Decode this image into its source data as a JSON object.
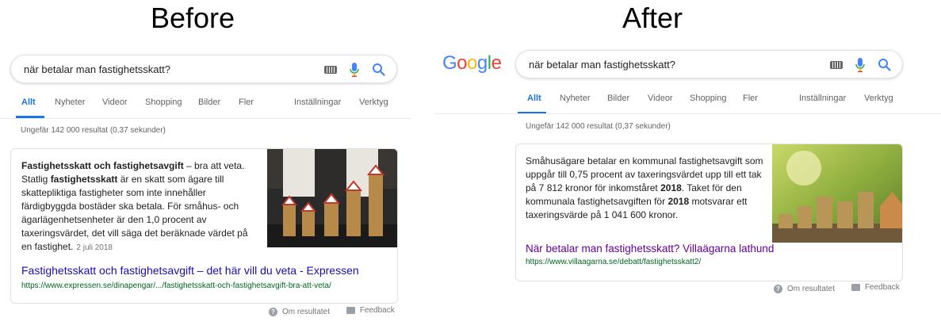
{
  "before": {
    "heading": "Before",
    "search": {
      "query": "när betalar man fastighetsskatt?"
    },
    "tabs": [
      {
        "label": "Allt",
        "active": true
      },
      {
        "label": "Nyheter"
      },
      {
        "label": "Videor"
      },
      {
        "label": "Shopping"
      },
      {
        "label": "Bilder"
      },
      {
        "label": "Fler"
      },
      {
        "label": "Inställningar"
      },
      {
        "label": "Verktyg"
      }
    ],
    "result_stats": "Ungefär 142 000 resultat (0,37 sekunder)",
    "snippet": {
      "bold_title": "Fastighetsskatt och fastighetsavgift",
      "text_a": " – bra att veta. Statlig ",
      "bold_term": "fastighetsskatt",
      "text_b": " är en skatt som ägare till skattepliktiga fastigheter som inte innehåller färdigbyggda bostäder ska betala. För småhus- och ägarlägenhetsenheter är den 1,0 procent av taxeringsvärdet, det vill säga det beräknade värdet på en fastighet.",
      "date": "2 juli 2018",
      "image_icon": "houses-on-coins-image"
    },
    "link": {
      "title": "Fastighetsskatt och fastighetsavgift – det här vill du veta - Expressen",
      "url": "https://www.expressen.se/dinapengar/.../fastighetsskatt-och-fastighetsavgift-bra-att-veta/"
    },
    "footer": {
      "about": "Om resultatet",
      "feedback": "Feedback"
    }
  },
  "after": {
    "heading": "After",
    "logo": "Google",
    "search": {
      "query": "när betalar man fastighetsskatt?"
    },
    "tabs": [
      {
        "label": "Allt",
        "active": true
      },
      {
        "label": "Nyheter"
      },
      {
        "label": "Bilder"
      },
      {
        "label": "Videor"
      },
      {
        "label": "Shopping"
      },
      {
        "label": "Fler"
      },
      {
        "label": "Inställningar"
      },
      {
        "label": "Verktyg"
      }
    ],
    "result_stats": "Ungefär 142 000 resultat (0,37 sekunder)",
    "snippet": {
      "text_a": "Småhusägare betalar en kommunal fastighetsavgift som uppgår till 0,75 procent av taxeringsvärdet upp till ett tak på 7 812 kronor för inkomståret ",
      "bold_year_1": "2018",
      "text_b": ". Taket för den kommunala fastighetsavgiften för ",
      "bold_year_2": "2018",
      "text_c": " motsvarar ett taxeringsvärde på 1 041 600 kronor.",
      "image_icon": "coins-and-house-image"
    },
    "link": {
      "title": "När betalar man fastighetsskatt? Villaägarna lathund",
      "url": "https://www.villaagarna.se/debatt/fastighetsskatt2/"
    },
    "footer": {
      "about": "Om resultatet",
      "feedback": "Feedback"
    }
  },
  "colors": {
    "link": "#1a0dab",
    "visited_link": "#660099",
    "url": "#006621",
    "active_tab": "#1a73e8",
    "muted": "#5f6368"
  }
}
